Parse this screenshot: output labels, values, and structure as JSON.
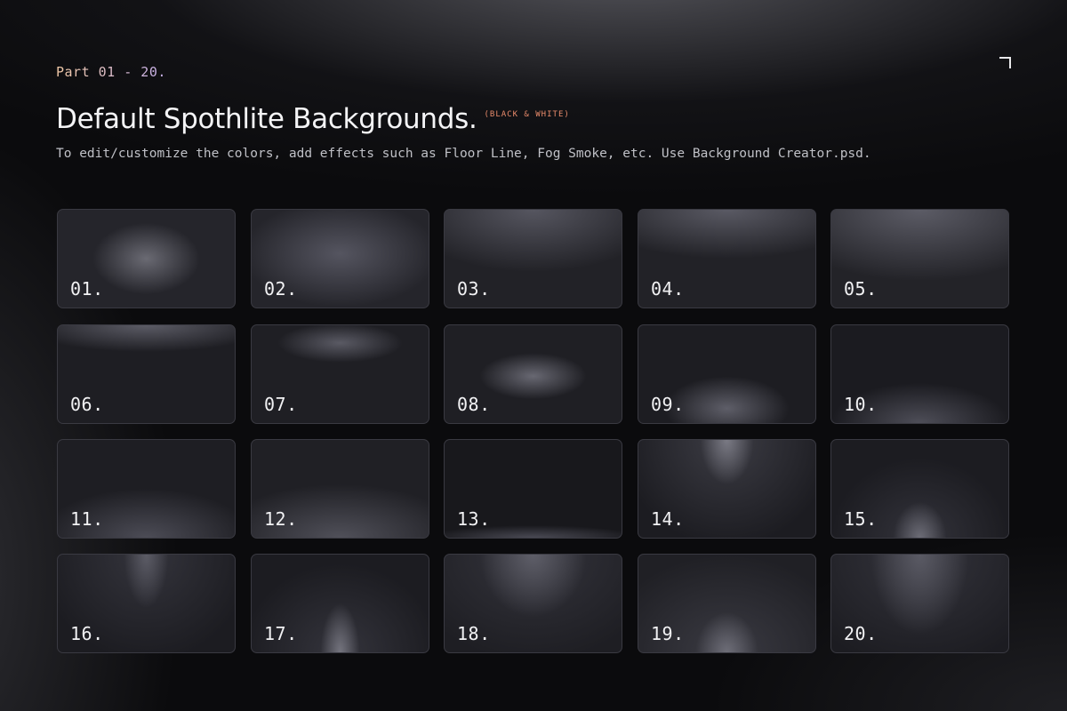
{
  "header": {
    "eyebrow": "Part 01 - 20.",
    "title": "Default Spothlite Backgrounds.",
    "title_tag": "(BLACK & WHITE)",
    "subtitle": "To edit/customize the colors, add effects such as Floor Line, Fog Smoke, etc. Use Background Creator.psd."
  },
  "accent_colors": {
    "eyebrow_gradient_start": "#f1c9a6",
    "eyebrow_gradient_end": "#c9b2ef",
    "tag": "#e98b6b"
  },
  "corner_icon": "corner-bracket-icon",
  "tiles": [
    {
      "number": "01."
    },
    {
      "number": "02."
    },
    {
      "number": "03."
    },
    {
      "number": "04."
    },
    {
      "number": "05."
    },
    {
      "number": "06."
    },
    {
      "number": "07."
    },
    {
      "number": "08."
    },
    {
      "number": "09."
    },
    {
      "number": "10."
    },
    {
      "number": "11."
    },
    {
      "number": "12."
    },
    {
      "number": "13."
    },
    {
      "number": "14."
    },
    {
      "number": "15."
    },
    {
      "number": "16."
    },
    {
      "number": "17."
    },
    {
      "number": "18."
    },
    {
      "number": "19."
    },
    {
      "number": "20."
    }
  ]
}
